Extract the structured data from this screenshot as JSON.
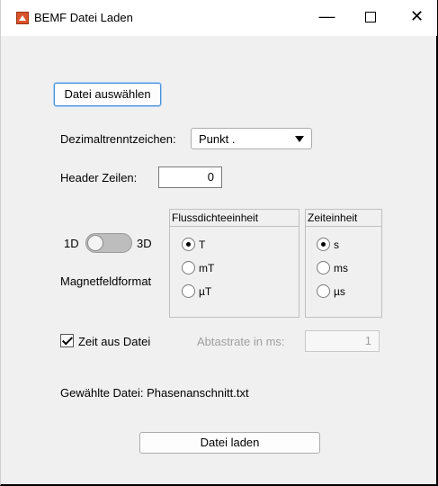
{
  "window": {
    "title": "BEMF Datei Laden",
    "minimize_glyph": "—",
    "close_glyph": "✕"
  },
  "file_select": {
    "label": "Datei auswählen"
  },
  "decimal": {
    "label": "Dezimaltrenntzeichen:",
    "selected": "Punkt ."
  },
  "header": {
    "label": "Header Zeilen:",
    "value": "0"
  },
  "toggle": {
    "left_label": "1D",
    "right_label": "3D",
    "caption": "Magnetfeldformat",
    "value": "1D"
  },
  "flux_unit": {
    "title": "Flussdichteeinheit",
    "options": [
      "T",
      "mT",
      "µT"
    ],
    "selected": "T"
  },
  "time_unit": {
    "title": "Zeiteinheit",
    "options": [
      "s",
      "ms",
      "µs"
    ],
    "selected": "s"
  },
  "time_from_file": {
    "label": "Zeit aus Datei",
    "checked": true
  },
  "sample_rate": {
    "label": "Abtastrate in ms:",
    "value": "1"
  },
  "selected_file": {
    "text": "Gewählte Datei: Phasenanschnitt.txt"
  },
  "load_button": {
    "label": "Datei laden"
  }
}
